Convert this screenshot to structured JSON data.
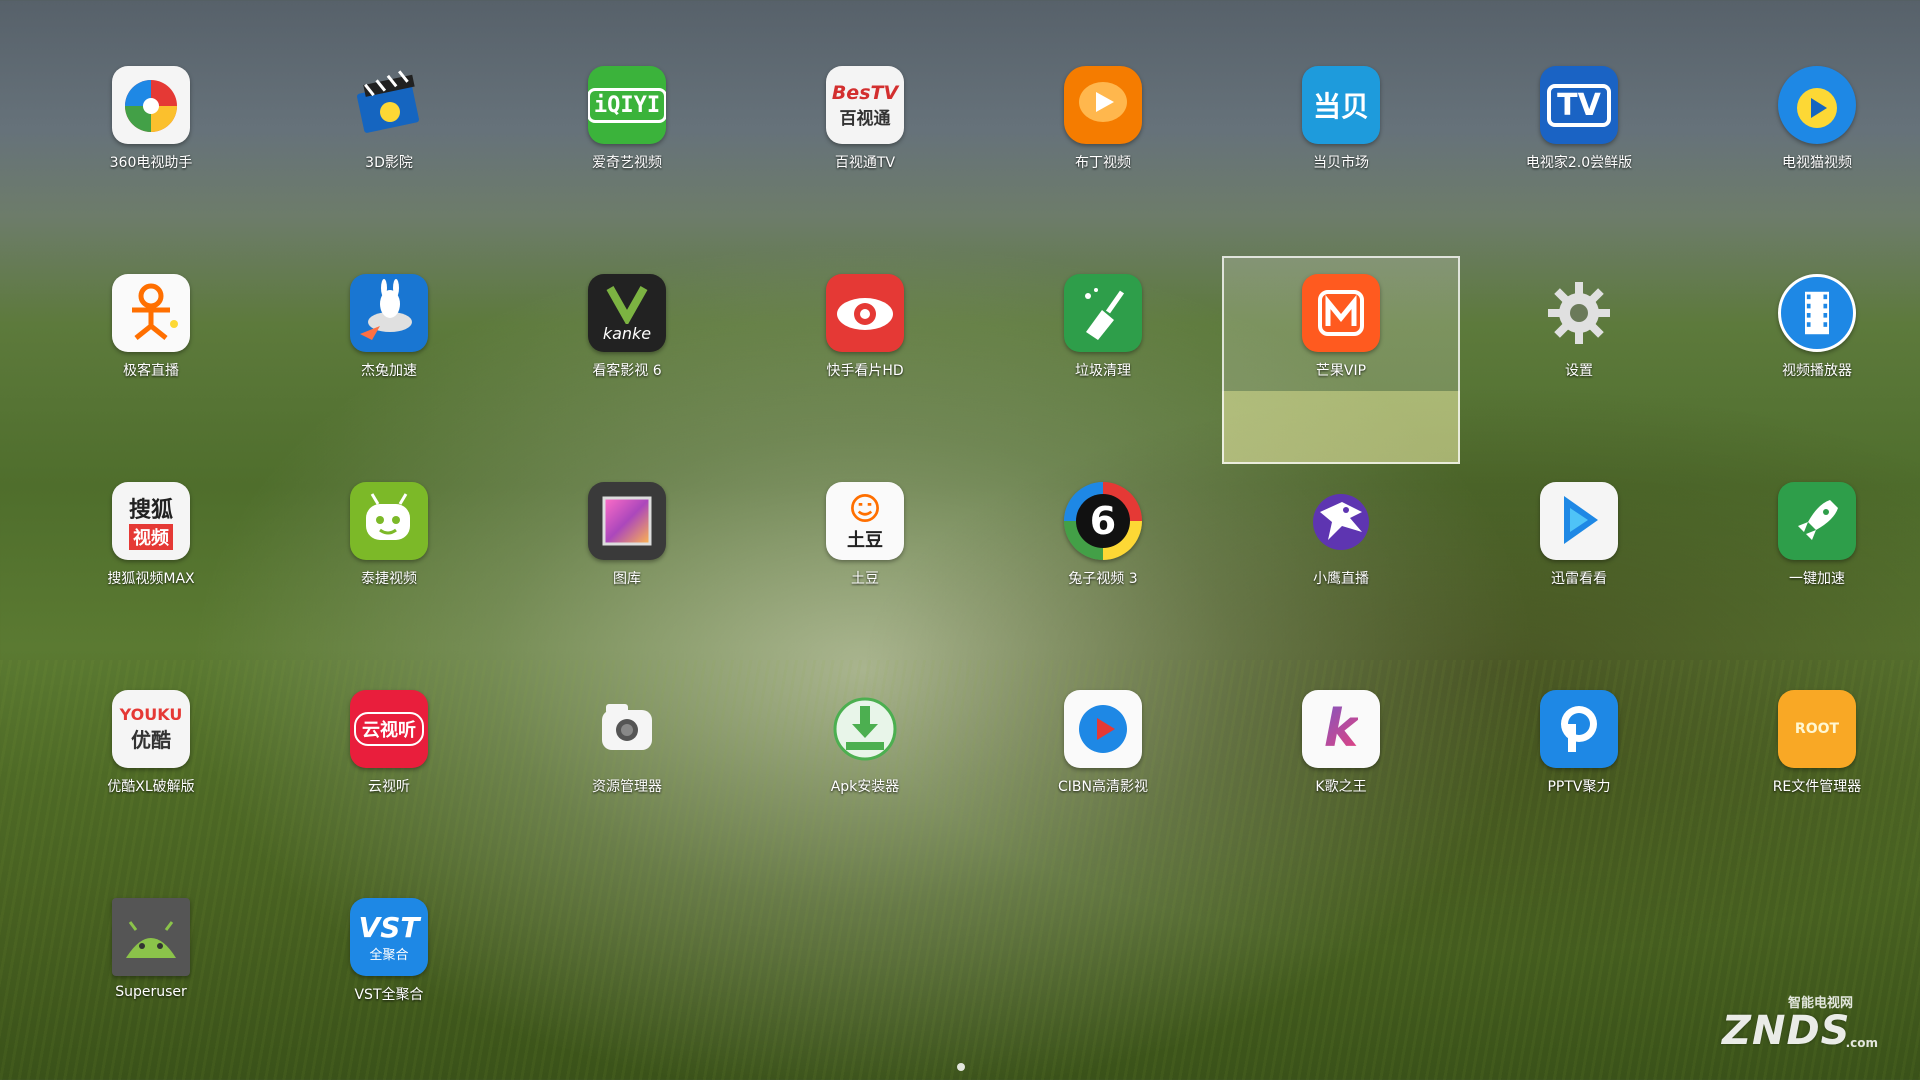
{
  "launcher": {
    "rows": [
      [
        {
          "label": "360电视助手",
          "icon": "360-tv-assistant-icon"
        },
        {
          "label": "3D影院",
          "icon": "3d-cinema-icon"
        },
        {
          "label": "爱奇艺视频",
          "icon": "iqiyi-icon",
          "icon_text": "iQIYI"
        },
        {
          "label": "百视通TV",
          "icon": "bestv-icon",
          "icon_text": "BesTV",
          "icon_text2": "百视通"
        },
        {
          "label": "布丁视频",
          "icon": "pudding-video-icon"
        },
        {
          "label": "当贝市场",
          "icon": "dangbei-market-icon",
          "icon_text": "当贝"
        },
        {
          "label": "电视家2.0尝鲜版",
          "icon": "dianshijia-icon",
          "icon_text": "TV"
        },
        {
          "label": "电视猫视频",
          "icon": "tvcat-icon"
        }
      ],
      [
        {
          "label": "极客直播",
          "icon": "geek-live-icon"
        },
        {
          "label": "杰兔加速",
          "icon": "jietu-accelerate-icon"
        },
        {
          "label": "看客影视 6",
          "icon": "kanke-icon",
          "icon_text": "kanke"
        },
        {
          "label": "快手看片HD",
          "icon": "kuaishou-hd-icon"
        },
        {
          "label": "垃圾清理",
          "icon": "cleaner-icon"
        },
        {
          "label": "芒果VIP",
          "icon": "mango-vip-icon",
          "focused": true
        },
        {
          "label": "设置",
          "icon": "settings-gear-icon"
        },
        {
          "label": "视频播放器",
          "icon": "video-player-icon"
        }
      ],
      [
        {
          "label": "搜狐视频MAX",
          "icon": "sohu-video-icon",
          "icon_text": "搜狐",
          "icon_text2": "视频"
        },
        {
          "label": "泰捷视频",
          "icon": "taijie-video-icon"
        },
        {
          "label": "图库",
          "icon": "gallery-icon"
        },
        {
          "label": "土豆",
          "icon": "tudou-icon",
          "icon_text": "土豆"
        },
        {
          "label": "兔子视频 3",
          "icon": "tuzi-video-icon",
          "icon_text": "6"
        },
        {
          "label": "小鹰直播",
          "icon": "xiaoying-live-icon"
        },
        {
          "label": "迅雷看看",
          "icon": "xunlei-kankan-icon"
        },
        {
          "label": "一键加速",
          "icon": "one-key-boost-icon"
        }
      ],
      [
        {
          "label": "优酷XL破解版",
          "icon": "youku-icon",
          "icon_text": "YOUKU",
          "icon_text2": "优酷"
        },
        {
          "label": "云视听",
          "icon": "yunshiting-icon",
          "icon_text": "云视听"
        },
        {
          "label": "资源管理器",
          "icon": "file-manager-icon"
        },
        {
          "label": "Apk安装器",
          "icon": "apk-installer-icon"
        },
        {
          "label": "CIBN高清影视",
          "icon": "cibn-icon"
        },
        {
          "label": "K歌之王",
          "icon": "k-song-king-icon",
          "icon_text": "k"
        },
        {
          "label": "PPTV聚力",
          "icon": "pptv-icon"
        },
        {
          "label": "RE文件管理器",
          "icon": "re-file-manager-icon",
          "icon_text": "ROOT"
        }
      ],
      [
        {
          "label": "Superuser",
          "icon": "superuser-android-icon"
        },
        {
          "label": "VST全聚合",
          "icon": "vst-icon",
          "icon_text": "VST",
          "icon_text2": "全聚合"
        }
      ]
    ],
    "page_indicator_count": 1,
    "watermark": {
      "main": "ZNDS",
      "sub": "智能电视网",
      "domain": ".com"
    }
  }
}
